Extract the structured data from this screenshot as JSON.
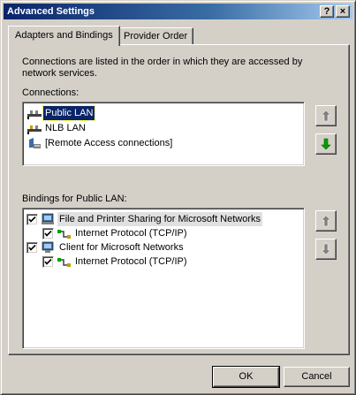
{
  "window": {
    "title": "Advanced Settings",
    "help_label": "?",
    "close_label": "×"
  },
  "tabs": [
    {
      "label": "Adapters and Bindings",
      "active": true
    },
    {
      "label": "Provider Order",
      "active": false
    }
  ],
  "description": "Connections are listed in the order in which they are accessed by network services.",
  "connections": {
    "label": "Connections:",
    "items": [
      {
        "label": "Public LAN",
        "icon": "network-adapter-icon",
        "selected": true
      },
      {
        "label": "NLB LAN",
        "icon": "network-adapter-icon",
        "selected": false
      },
      {
        "label": "[Remote Access connections]",
        "icon": "remote-access-icon",
        "selected": false
      }
    ]
  },
  "bindings": {
    "label": "Bindings for Public LAN:",
    "items": [
      {
        "label": "File and Printer Sharing for Microsoft Networks",
        "checked": true,
        "level": 0,
        "icon": "file-printer-sharing-icon",
        "highlight": true
      },
      {
        "label": "Internet Protocol (TCP/IP)",
        "checked": true,
        "level": 1,
        "icon": "protocol-icon",
        "highlight": false
      },
      {
        "label": "Client for Microsoft Networks",
        "checked": true,
        "level": 0,
        "icon": "client-icon",
        "highlight": false
      },
      {
        "label": "Internet Protocol (TCP/IP)",
        "checked": true,
        "level": 1,
        "icon": "protocol-icon",
        "highlight": false
      }
    ]
  },
  "buttons": {
    "ok": "OK",
    "cancel": "Cancel"
  },
  "colors": {
    "title_start": "#0a246a",
    "title_end": "#a6caf0",
    "face": "#d4d0c8",
    "selection": "#0a246a",
    "arrow_green": "#00a000"
  }
}
